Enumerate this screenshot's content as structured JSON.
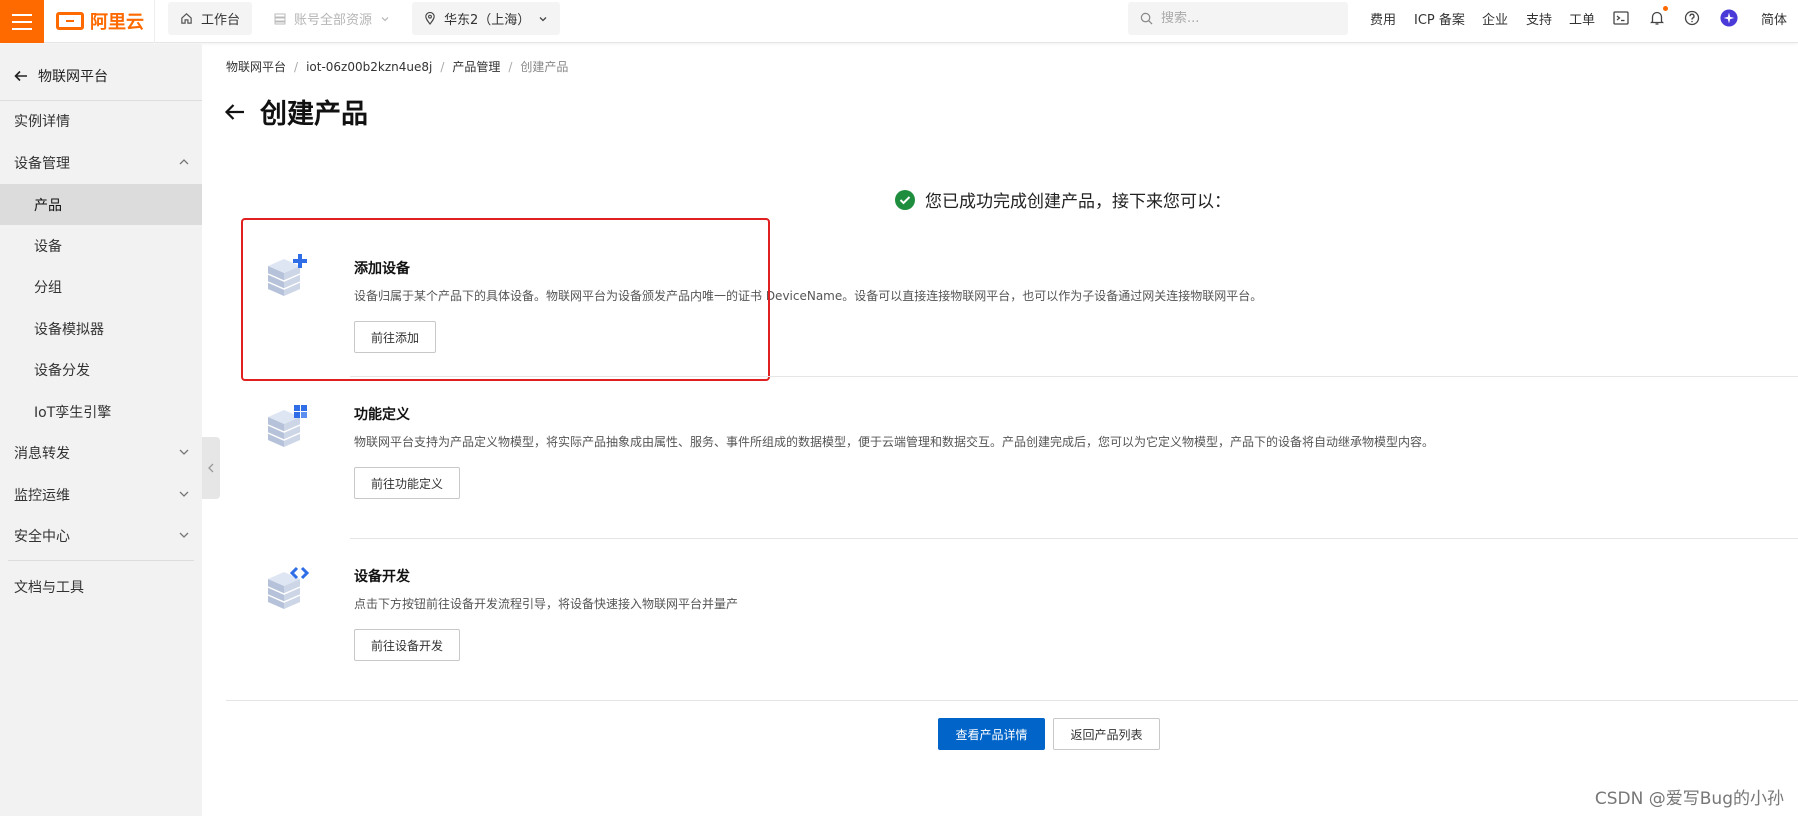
{
  "topbar": {
    "logo_text": "阿里云",
    "workbench": "工作台",
    "resource_scope": "账号全部资源",
    "region": "华东2（上海）",
    "search_placeholder": "搜索...",
    "nav": [
      "费用",
      "ICP 备案",
      "企业",
      "支持",
      "工单"
    ],
    "language": "简体",
    "icons": [
      "terminal-icon",
      "bell-icon",
      "help-icon",
      "avatar-icon"
    ]
  },
  "sidebar": {
    "back_label": "物联网平台",
    "items": [
      {
        "label": "实例详情",
        "level": "top",
        "icon": null
      },
      {
        "label": "设备管理",
        "level": "top",
        "icon": "chevron-up-icon"
      },
      {
        "label": "产品",
        "level": "sub",
        "active": true
      },
      {
        "label": "设备",
        "level": "sub"
      },
      {
        "label": "分组",
        "level": "sub"
      },
      {
        "label": "设备模拟器",
        "level": "sub"
      },
      {
        "label": "设备分发",
        "level": "sub"
      },
      {
        "label": "IoT孪生引擎",
        "level": "sub"
      },
      {
        "label": "消息转发",
        "level": "top",
        "icon": "chevron-down-icon"
      },
      {
        "label": "监控运维",
        "level": "top",
        "icon": "chevron-down-icon"
      },
      {
        "label": "安全中心",
        "level": "top",
        "icon": "chevron-down-icon"
      },
      {
        "label": "文档与工具",
        "level": "top",
        "icon": null
      }
    ]
  },
  "breadcrumb": [
    "物联网平台",
    "iot-06z00b2kzn4ue8j",
    "产品管理",
    "创建产品"
  ],
  "page_title": "创建产品",
  "success_message": "您已成功完成创建产品，接下来您可以：",
  "steps": [
    {
      "title": "添加设备",
      "description": "设备归属于某个产品下的具体设备。物联网平台为设备颁发产品内唯一的证书 DeviceName。设备可以直接连接物联网平台，也可以作为子设备通过网关连接物联网平台。",
      "button": "前往添加",
      "icon": "add-device-icon"
    },
    {
      "title": "功能定义",
      "description": "物联网平台支持为产品定义物模型，将实际产品抽象成由属性、服务、事件所组成的数据模型，便于云端管理和数据交互。产品创建完成后，您可以为它定义物模型，产品下的设备将自动继承物模型内容。",
      "button": "前往功能定义",
      "icon": "feature-definition-icon"
    },
    {
      "title": "设备开发",
      "description": "点击下方按钮前往设备开发流程引导，将设备快速接入物联网平台并量产",
      "button": "前往设备开发",
      "icon": "device-dev-icon"
    }
  ],
  "footer_buttons": {
    "primary": "查看产品详情",
    "secondary": "返回产品列表"
  },
  "watermark": "CSDN @爱写Bug的小孙",
  "colors": {
    "brand": "#ff6a00",
    "primary": "#0064c8",
    "success": "#1e8e3e",
    "highlight": "#e02020"
  }
}
